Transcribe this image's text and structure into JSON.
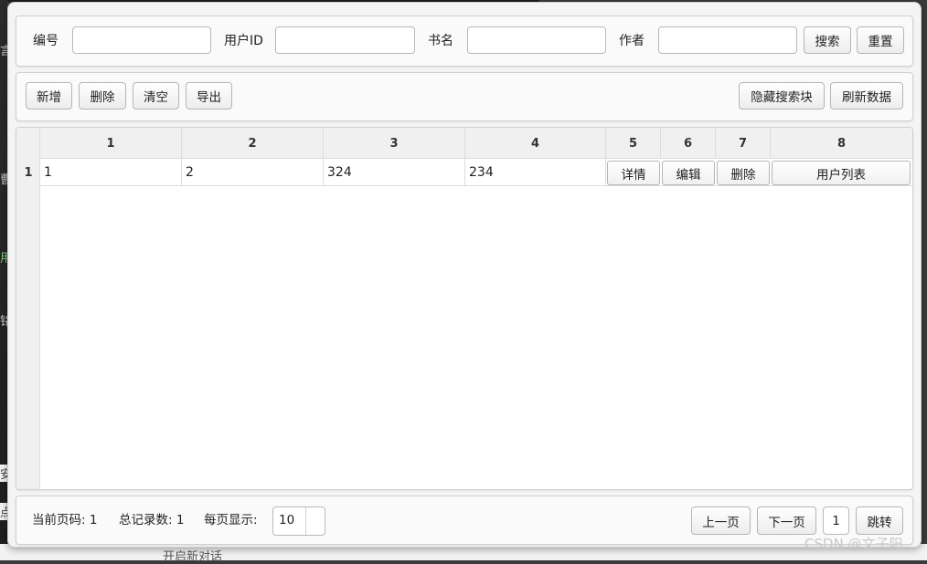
{
  "background": {
    "left_chars": [
      "言",
      "曹",
      "用",
      "铭",
      "安",
      "点"
    ],
    "bottom_text": "开启新对话"
  },
  "search": {
    "fields": [
      {
        "label": "编号",
        "value": "",
        "placeholder": ""
      },
      {
        "label": "用户ID",
        "value": "",
        "placeholder": ""
      },
      {
        "label": "书名",
        "value": "",
        "placeholder": ""
      },
      {
        "label": "作者",
        "value": "",
        "placeholder": ""
      }
    ],
    "search_label": "搜索",
    "reset_label": "重置"
  },
  "toolbar": {
    "add_label": "新增",
    "delete_label": "删除",
    "clear_label": "清空",
    "export_label": "导出",
    "hide_search_label": "隐藏搜索块",
    "refresh_label": "刷新数据"
  },
  "table": {
    "columns": [
      "1",
      "2",
      "3",
      "4",
      "5",
      "6",
      "7",
      "8"
    ],
    "rows": [
      {
        "row_number": "1",
        "cells": [
          "1",
          "2",
          "324",
          "234"
        ],
        "actions": [
          "详情",
          "编辑",
          "删除",
          "用户列表"
        ]
      }
    ]
  },
  "pagination": {
    "current_page_label": "当前页码: 1",
    "total_label": "总记录数: 1",
    "page_size_label": "每页显示:",
    "page_size_value": "10",
    "prev_label": "上一页",
    "next_label": "下一页",
    "jump_page_value": "1",
    "jump_label": "跳转"
  },
  "watermark": "CSDN @文子阳",
  "colors": {
    "window_bg": "#f4f4f4",
    "panel_bg": "#fafafa",
    "grid_header_bg": "#f0f0f0"
  }
}
